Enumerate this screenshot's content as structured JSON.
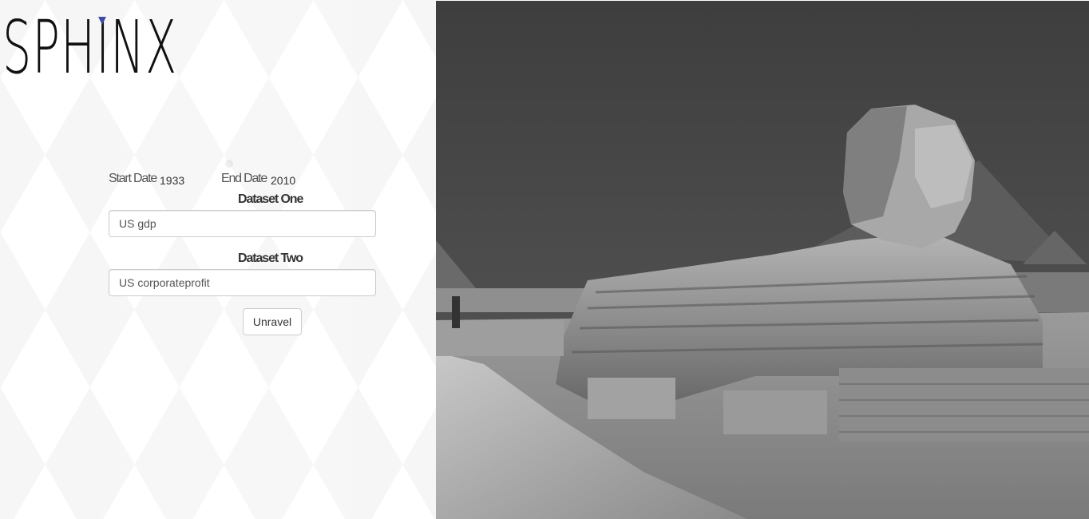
{
  "app": {
    "logo_text": "SPHINX",
    "accent_color": "#3c4aa3"
  },
  "form": {
    "start_date_label": "Start Date",
    "start_date_value": "1933",
    "end_date_label": "End Date",
    "end_date_value": "2010",
    "dataset_one_label": "Dataset One",
    "dataset_one_value": "US gdp",
    "dataset_two_label": "Dataset Two",
    "dataset_two_value": "US corporateprofit",
    "submit_label": "Unravel"
  },
  "hero_image": {
    "subject": "great-sphinx-photo",
    "style": "black-and-white"
  }
}
